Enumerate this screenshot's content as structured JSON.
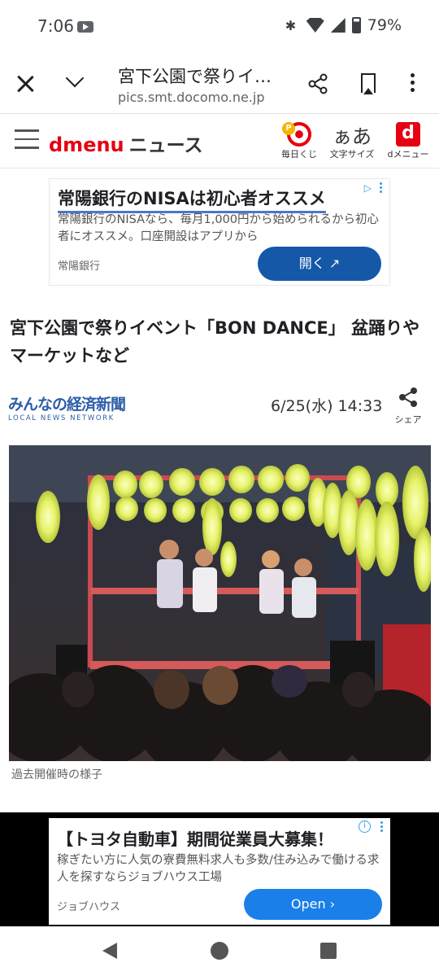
{
  "status_bar": {
    "time": "7:06",
    "battery": "79%"
  },
  "browser": {
    "page_title": "宮下公園で祭りイ…",
    "url": "pics.smt.docomo.ne.jp"
  },
  "site_header": {
    "logo_d": "dmenu",
    "logo_news": "ニュース",
    "items": [
      {
        "label": "毎日くじ",
        "icon": "lottery-target-icon"
      },
      {
        "label": "文字サイズ",
        "icon_text": "ぁあ"
      },
      {
        "label": "dメニュー",
        "icon_text": "d"
      }
    ]
  },
  "ad_top": {
    "title": "常陽銀行のNISAは初心者オススメ",
    "body": "常陽銀行のNISAなら、毎月1,000円から始められるから初心者にオススメ。口座開設はアプリから",
    "advertiser": "常陽銀行",
    "button": "開く ↗"
  },
  "article": {
    "title": "宮下公園で祭りイベント「BON DANCE」 盆踊りやマーケットなど",
    "source_jp": "みんなの経済新聞",
    "source_en": "LOCAL NEWS NETWORK",
    "date": "6/25(水) 14:33",
    "share_label": "シェア",
    "photo_caption": "過去開催時の様子"
  },
  "ad_bottom": {
    "title": "【トヨタ自動車】期間従業員大募集！",
    "body": "稼ぎたい方に人気の寮費無料求人も多数/住み込みで働ける求人を探すならジョブハウス工場",
    "advertiser": "ジョブハウス",
    "button": "Open ›"
  }
}
